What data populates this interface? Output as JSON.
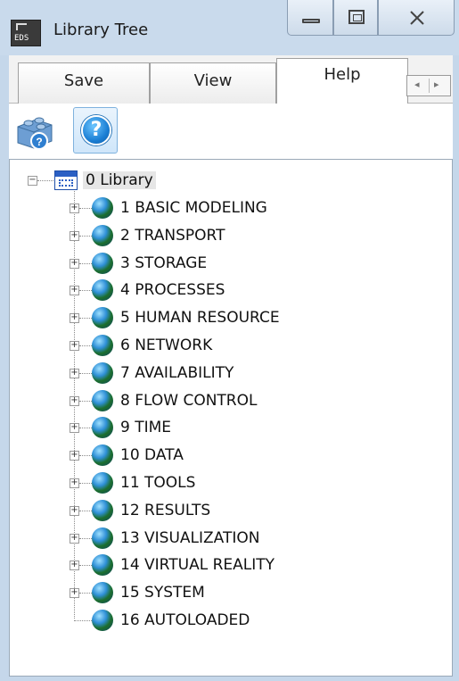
{
  "window": {
    "title": "Library Tree",
    "app_icon_text": "EDS"
  },
  "tabs": [
    {
      "label": "Save"
    },
    {
      "label": "View"
    },
    {
      "label": "Help"
    }
  ],
  "tab_scroll": {
    "left_glyph": "◂",
    "right_glyph": "▸"
  },
  "toolbar": {
    "help_symbol": "?"
  },
  "tree": {
    "root": {
      "label": "0 Library",
      "expander": "−"
    },
    "items": [
      {
        "label": "1 BASIC MODELING",
        "expander": "+"
      },
      {
        "label": "2 TRANSPORT",
        "expander": "+"
      },
      {
        "label": "3 STORAGE",
        "expander": "+"
      },
      {
        "label": "4 PROCESSES",
        "expander": "+"
      },
      {
        "label": "5 HUMAN RESOURCE",
        "expander": "+"
      },
      {
        "label": "6 NETWORK",
        "expander": "+"
      },
      {
        "label": "7 AVAILABILITY",
        "expander": "+"
      },
      {
        "label": "8 FLOW CONTROL",
        "expander": "+"
      },
      {
        "label": "9 TIME",
        "expander": "+"
      },
      {
        "label": "10 DATA",
        "expander": "+"
      },
      {
        "label": "11 TOOLS",
        "expander": "+"
      },
      {
        "label": "12 RESULTS",
        "expander": "+"
      },
      {
        "label": "13 VISUALIZATION",
        "expander": "+"
      },
      {
        "label": "14 VIRTUAL REALITY",
        "expander": "+"
      },
      {
        "label": "15 SYSTEM",
        "expander": "+"
      },
      {
        "label": "16 AUTOLOADED",
        "expander": ""
      }
    ]
  },
  "colors": {
    "titlebar": "#c9daec",
    "accent": "#2a76b8"
  }
}
